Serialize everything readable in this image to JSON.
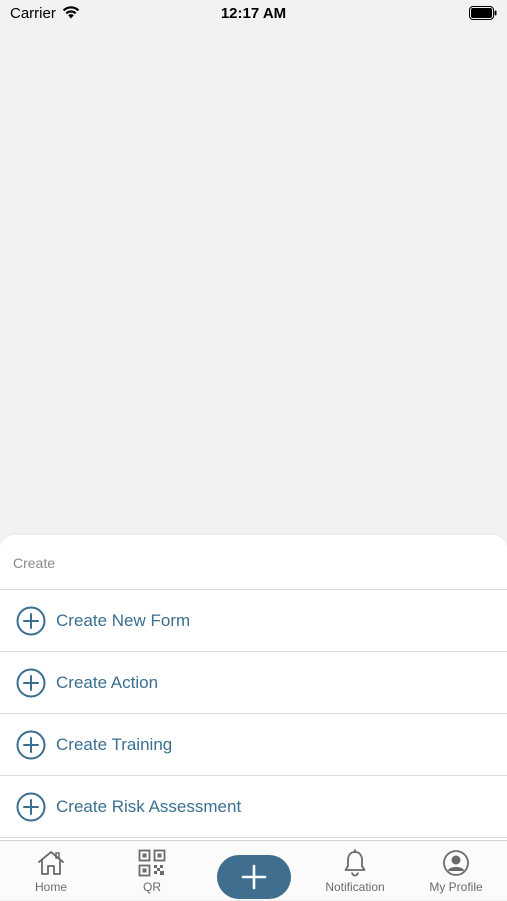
{
  "status_bar": {
    "carrier": "Carrier",
    "time": "12:17 AM"
  },
  "sheet": {
    "title": "Create",
    "items": [
      {
        "label": "Create New Form",
        "icon": "plus-circle-icon"
      },
      {
        "label": "Create Action",
        "icon": "plus-circle-icon"
      },
      {
        "label": "Create Training",
        "icon": "plus-circle-icon"
      },
      {
        "label": "Create Risk Assessment",
        "icon": "plus-circle-icon"
      }
    ]
  },
  "tabbar": {
    "tabs": [
      {
        "label": "Home",
        "icon": "home-icon"
      },
      {
        "label": "QR",
        "icon": "qr-code-icon"
      },
      {
        "label": "Notification",
        "icon": "bell-icon"
      },
      {
        "label": "My Profile",
        "icon": "profile-icon"
      }
    ],
    "fab_icon": "plus-icon"
  },
  "colors": {
    "accent": "#3f6e8e",
    "item_text": "#3a6f8f",
    "background": "#f2f2f2"
  }
}
